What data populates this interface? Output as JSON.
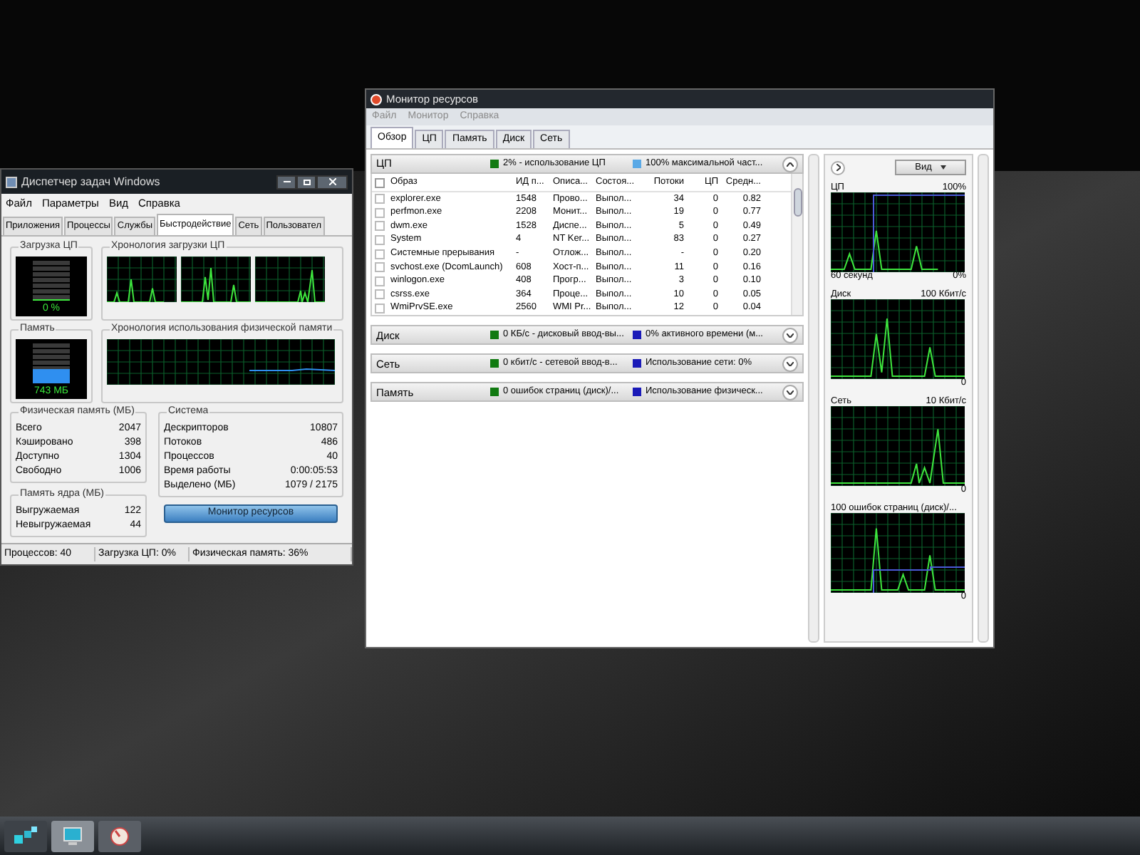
{
  "task_manager": {
    "title": "Диспетчер задач Windows",
    "menu": [
      "Файл",
      "Параметры",
      "Вид",
      "Справка"
    ],
    "tabs": [
      {
        "label": "Приложения",
        "selected": false
      },
      {
        "label": "Процессы",
        "selected": false
      },
      {
        "label": "Службы",
        "selected": false
      },
      {
        "label": "Быстродействие",
        "selected": true
      },
      {
        "label": "Сеть",
        "selected": false
      },
      {
        "label": "Пользовател",
        "selected": false
      }
    ],
    "cpu_usage": {
      "title": "Загрузка ЦП",
      "reading": "0 %",
      "level": 0
    },
    "cpu_history": {
      "title": "Хронология загрузки ЦП"
    },
    "memory": {
      "title": "Память",
      "reading": "743 МБ",
      "level": 0.36
    },
    "memory_history": {
      "title": "Хронология использования физической памяти"
    },
    "physical_memory": {
      "title": "Физическая память (МБ)",
      "rows": [
        {
          "label": "Всего",
          "value": "2047"
        },
        {
          "label": "Кэшировано",
          "value": "398"
        },
        {
          "label": "Доступно",
          "value": "1304"
        },
        {
          "label": "Свободно",
          "value": "1006"
        }
      ]
    },
    "system": {
      "title": "Система",
      "rows": [
        {
          "label": "Дескрипторов",
          "value": "10807"
        },
        {
          "label": "Потоков",
          "value": "486"
        },
        {
          "label": "Процессов",
          "value": "40"
        },
        {
          "label": "Время работы",
          "value": "0:00:05:53"
        },
        {
          "label": "Выделено (МБ)",
          "value": "1079 / 2175"
        }
      ]
    },
    "kernel_memory": {
      "title": "Память ядра (МБ)",
      "rows": [
        {
          "label": "Выгружаемая",
          "value": "122"
        },
        {
          "label": "Невыгружаемая",
          "value": "44"
        }
      ]
    },
    "resource_monitor_button": "Монитор ресурсов",
    "status_bar": [
      "Процессов: 40",
      "Загрузка ЦП: 0%",
      "Физическая память: 36%"
    ]
  },
  "resource_monitor": {
    "title": "Монитор ресурсов",
    "menu": [
      "Файл",
      "Монитор",
      "Справка"
    ],
    "tabs": [
      {
        "label": "Обзор",
        "selected": true
      },
      {
        "label": "ЦП",
        "selected": false
      },
      {
        "label": "Память",
        "selected": false
      },
      {
        "label": "Диск",
        "selected": false
      },
      {
        "label": "Сеть",
        "selected": false
      }
    ],
    "sections": [
      {
        "title": "ЦП",
        "expanded": true,
        "stats": [
          {
            "text": "2% - использование ЦП",
            "color": "#117a11"
          },
          {
            "text": "100% максимальной част...",
            "color": "#5aa9e6"
          }
        ]
      },
      {
        "title": "Диск",
        "expanded": false,
        "stats": [
          {
            "text": "0 КБ/с - дисковый ввод-вы...",
            "color": "#117a11"
          },
          {
            "text": "0% активного времени (м...",
            "color": "#1a1ab8"
          }
        ]
      },
      {
        "title": "Сеть",
        "expanded": false,
        "stats": [
          {
            "text": "0 кбит/с - сетевой ввод-в...",
            "color": "#117a11"
          },
          {
            "text": "Использование сети: 0%",
            "color": "#1a1ab8"
          }
        ]
      },
      {
        "title": "Память",
        "expanded": false,
        "stats": [
          {
            "text": "0 ошибок страниц (диск)/...",
            "color": "#117a11"
          },
          {
            "text": "Использование физическ...",
            "color": "#1a1ab8"
          }
        ]
      }
    ],
    "cpu_table": {
      "all_checked": false,
      "columns": [
        "Образ",
        "ИД п...",
        "Описа...",
        "Состоя...",
        "Потоки",
        "ЦП",
        "Средн..."
      ],
      "rows": [
        {
          "checked": false,
          "cells": [
            "explorer.exe",
            "1548",
            "Прово...",
            "Выпол...",
            "34",
            "0",
            "0.82"
          ]
        },
        {
          "checked": false,
          "cells": [
            "perfmon.exe",
            "2208",
            "Монит...",
            "Выпол...",
            "19",
            "0",
            "0.77"
          ]
        },
        {
          "checked": false,
          "cells": [
            "dwm.exe",
            "1528",
            "Диспе...",
            "Выпол...",
            "5",
            "0",
            "0.49"
          ]
        },
        {
          "checked": false,
          "cells": [
            "System",
            "4",
            "NT Ker...",
            "Выпол...",
            "83",
            "0",
            "0.27"
          ]
        },
        {
          "checked": false,
          "cells": [
            "Системные прерывания",
            "-",
            "Отлож...",
            "Выпол...",
            "-",
            "0",
            "0.20"
          ]
        },
        {
          "checked": false,
          "cells": [
            "svchost.exe (DcomLaunch)",
            "608",
            "Хост-п...",
            "Выпол...",
            "11",
            "0",
            "0.16"
          ]
        },
        {
          "checked": false,
          "cells": [
            "winlogon.exe",
            "408",
            "Прогр...",
            "Выпол...",
            "3",
            "0",
            "0.10"
          ]
        },
        {
          "checked": false,
          "cells": [
            "csrss.exe",
            "364",
            "Проце...",
            "Выпол...",
            "10",
            "0",
            "0.05"
          ]
        },
        {
          "checked": false,
          "cells": [
            "WmiPrvSE.exe",
            "2560",
            "WMI Pr...",
            "Выпол...",
            "12",
            "0",
            "0.04"
          ]
        }
      ]
    },
    "view_button": "Вид",
    "graphs": [
      {
        "title": "ЦП",
        "max": "100%",
        "footer": "60 секунд",
        "min": "0%"
      },
      {
        "title": "Диск",
        "max": "100 Кбит/с",
        "min": "0"
      },
      {
        "title": "Сеть",
        "max": "10 Кбит/с",
        "min": "0"
      },
      {
        "title": "100 ошибок страниц (диск)/...",
        "min": "0"
      }
    ]
  }
}
